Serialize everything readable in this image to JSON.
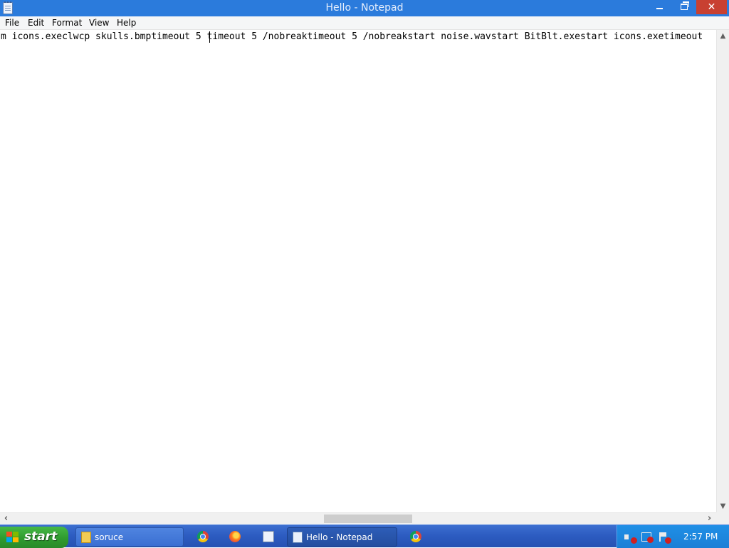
{
  "window": {
    "title": "Hello - Notepad",
    "app_icon": "notepad-icon",
    "controls": [
      "minimize-icon",
      "restore-icon",
      "close-icon"
    ],
    "close_label": "✕"
  },
  "menu": {
    "items": [
      {
        "label": "File"
      },
      {
        "label": "Edit"
      },
      {
        "label": "Format"
      },
      {
        "label": "View"
      },
      {
        "label": "Help"
      }
    ]
  },
  "editor": {
    "text": "m icons.execlwcp skulls.bmptimeout 5 timeout 5 /nobreaktimeout 5 /nobreakstart noise.wavstart BitBlt.exestart icons.exetimeout"
  },
  "scrollbars": {
    "up_arrow": "▲",
    "down_arrow": "▼",
    "left_arrow": "‹",
    "right_arrow": "›",
    "horizontal_position": 0.5
  },
  "taskbar": {
    "start_label": "start",
    "tasks": [
      {
        "label": "soruce",
        "icon": "folder-icon"
      },
      {
        "label": "Hello - Notepad",
        "icon": "notepad-icon",
        "active": true
      }
    ],
    "quick_launch": [
      "chrome-icon",
      "firefox-icon",
      "notepad-icon",
      "chrome-icon"
    ],
    "tray_icons": [
      "speaker-muted-icon",
      "network-disconnected-icon",
      "action-center-icon"
    ],
    "clock": "2:57 PM"
  },
  "colors": {
    "titlebar": "#2b7bdc",
    "close_button": "#c84031",
    "taskbar": "#2c5bc0",
    "start_button": "#2f9b2f",
    "tray": "#1b7fd6"
  }
}
